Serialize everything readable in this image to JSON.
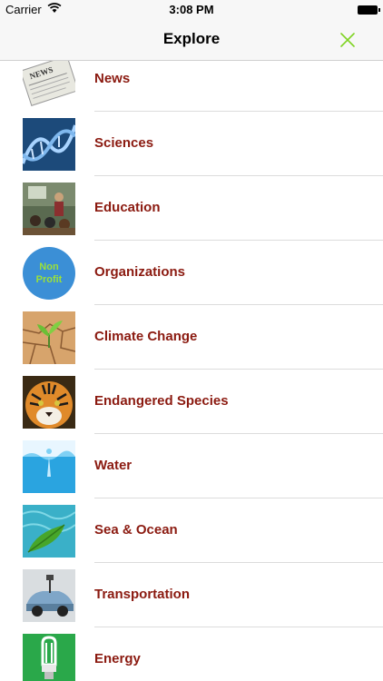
{
  "status_bar": {
    "carrier": "Carrier",
    "time": "3:08 PM"
  },
  "nav": {
    "title": "Explore",
    "close_icon": "close-icon",
    "accent": "#7ed321"
  },
  "label_color": "#8b1a10",
  "categories": [
    {
      "label": "News",
      "icon": "newspaper-icon"
    },
    {
      "label": "Sciences",
      "icon": "dna-helix-icon"
    },
    {
      "label": "Education",
      "icon": "classroom-icon"
    },
    {
      "label": "Organizations",
      "icon": "nonprofit-badge-icon",
      "badge_text": [
        "Non",
        "Profit"
      ]
    },
    {
      "label": "Climate Change",
      "icon": "sprout-dry-soil-icon"
    },
    {
      "label": "Endangered Species",
      "icon": "tiger-icon"
    },
    {
      "label": "Water",
      "icon": "water-splash-icon"
    },
    {
      "label": "Sea & Ocean",
      "icon": "leaf-in-sea-icon"
    },
    {
      "label": "Transportation",
      "icon": "electric-car-icon"
    },
    {
      "label": "Energy",
      "icon": "cfl-bulb-icon"
    }
  ]
}
